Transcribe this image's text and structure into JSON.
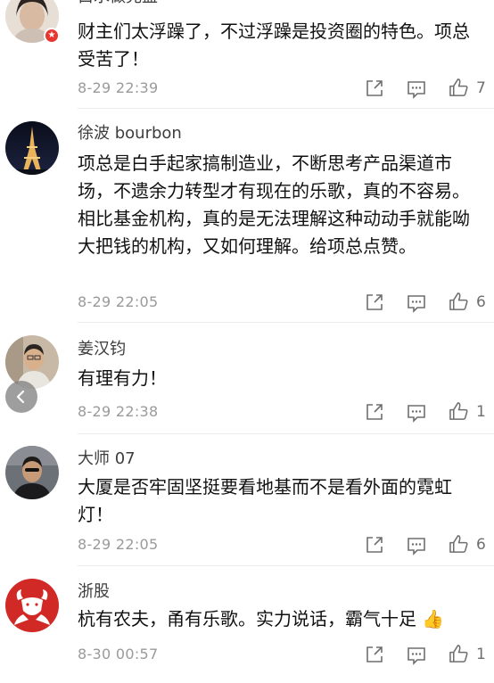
{
  "comments": [
    {
      "username": "白水做完盘",
      "text": "财主们太浮躁了，不过浮躁是投资圈的特色。项总受苦了！",
      "time": "8-29 22:39",
      "likes": "7",
      "badge": "★"
    },
    {
      "username": "徐波 bourbon",
      "text": "项总是白手起家搞制造业，不断思考产品渠道市场，不遗余力转型才有现在的乐歌，真的不容易。相比基金机构，真的是无法理解这种动动手就能呦大把钱的机构，又如何理解。给项总点赞。",
      "time": "8-29 22:05",
      "likes": "6"
    },
    {
      "username": "姜汉钧",
      "text": "有理有力！",
      "time": "8-29 22:38",
      "likes": "1"
    },
    {
      "username": "大师 07",
      "text": "大厦是否牢固坚挺要看地基而不是看外面的霓虹灯！",
      "time": "8-29 22:05",
      "likes": "6"
    },
    {
      "username": "浙股",
      "text": "杭有农夫，甬有乐歌。实力说话，霸气十足",
      "emoji": "👍",
      "time": "8-30 00:57",
      "likes": "1"
    }
  ],
  "icons": {
    "share": "share-icon",
    "comment": "comment-icon",
    "like": "thumbs-up-icon",
    "back": "chevron-left-icon"
  },
  "colors": {
    "meta": "#9a9a9a",
    "divider": "#ececec",
    "badge": "#e8352e"
  }
}
